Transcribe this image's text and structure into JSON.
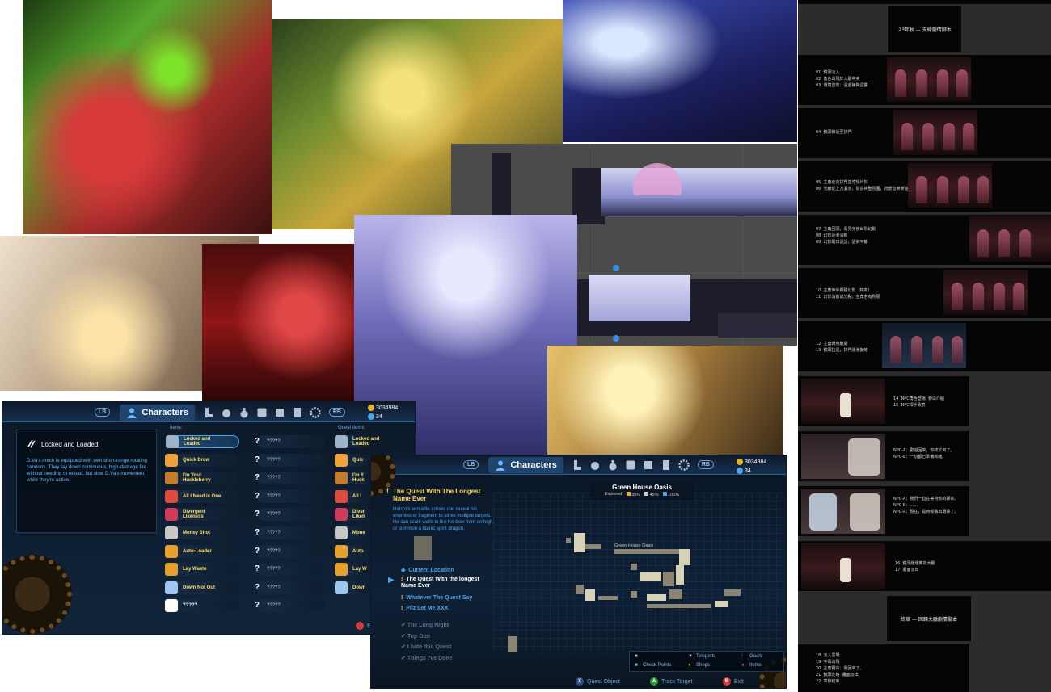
{
  "characters_ui": {
    "lb": "LB",
    "rb": "RB",
    "tab_label": "Characters",
    "gold": "3034984",
    "gems": "34",
    "detail": {
      "title": "Locked and Loaded",
      "description": "D.Va's mech is equipped with twin short-range rotating cannons. They lay down continuous, high-damage fire without needing to reload, but slow D.Va's movement while they're active."
    },
    "items_header": "Items",
    "quest_items_header": "Quest Items",
    "items": [
      {
        "label": "Locked and\nLoaded",
        "color": "#9fb3c8"
      },
      {
        "label": "Quick Draw",
        "color": "#f0a23a"
      },
      {
        "label": "I'm Your\nHuckleberry",
        "color": "#c27c2e"
      },
      {
        "label": "All I Need is One",
        "color": "#e04a3c"
      },
      {
        "label": "Divergent\nLikeness",
        "color": "#d23a5a"
      },
      {
        "label": "Money Shot",
        "color": "#c8c8c8"
      },
      {
        "label": "Auto-Loader",
        "color": "#e6a12c"
      },
      {
        "label": "Lay Waste",
        "color": "#e6a12c"
      },
      {
        "label": "Down Not Out",
        "color": "#9ec7f0"
      },
      {
        "label": "?????",
        "color": "#ffffff"
      }
    ],
    "unknown": "?????",
    "quest_items": [
      {
        "label": "Locked and\nLoaded",
        "color": "#9fb3c8"
      },
      {
        "label": "Quic",
        "color": "#f0a23a"
      },
      {
        "label": "I'm Y\nHuck",
        "color": "#c27c2e"
      },
      {
        "label": "All I",
        "color": "#e04a3c"
      },
      {
        "label": "Diver\nLiken",
        "color": "#d23a5a"
      },
      {
        "label": "Mone",
        "color": "#c8c8c8"
      },
      {
        "label": "Auto",
        "color": "#e6a12c"
      },
      {
        "label": "Lay W",
        "color": "#e6a12c"
      },
      {
        "label": "Down",
        "color": "#9ec7f0"
      }
    ],
    "exit_label": "E"
  },
  "quest_ui": {
    "lb": "LB",
    "rb": "RB",
    "tab_label": "Characters",
    "gold": "3034984",
    "gems": "34",
    "quest_title": "The Quest With The Longest Name Ever",
    "quest_description": "Hanzo's versatile arrows can reveal his enemies or fragment to strike multiple targets. He can scale walls to fire his bow from on high, or summon a titanic spirit dragon.",
    "map_title": "Green House Oasis",
    "explored_label": "Explored",
    "explored": [
      {
        "value": "35%",
        "color": "#e6b325"
      },
      {
        "value": "45%",
        "color": "#c8c8c8"
      },
      {
        "value": "100%",
        "color": "#4ea3e6"
      }
    ],
    "map_area_label": "Green House Oasis",
    "current_location": "Current Location",
    "quests_active": [
      {
        "label": "The Quest With the longest\nName Ever",
        "color": "#ffffff"
      },
      {
        "label": "Whatever The Quest Say",
        "color": "#4ea3e6"
      },
      {
        "label": "Pliz Let Me XXX",
        "color": "#4ea3e6"
      }
    ],
    "quests_done": [
      "The Long Night",
      "Top Gun",
      "I hate this Quest",
      "Things I've Done"
    ],
    "legend": {
      "check_points": "Check Points",
      "teleports": "Teleports",
      "shops": "Shops",
      "goals": "Goals",
      "items": "Items"
    },
    "actions": {
      "quest_object": "Quest Object",
      "track_target": "Track Target",
      "exit": "Exit"
    },
    "action_buttons": {
      "x": "X",
      "a": "A",
      "b": "B"
    }
  },
  "storyboard": {
    "title_1": "23年秋 — 支線劇情腳本",
    "title_2": "終章 — 回歸大廳劇情腳本",
    "notes": [
      "01  鏡頭淡入\n02  角色出現於大廳中央\n03  環境音效：遠處鐘聲迴響",
      "04  鏡頭推近至拱門",
      "05  主角走向拱門並停頓片刻\n06  光線從上方灑落，營造神聖氛圍，背景音樂漸強",
      "07  主角回頭，看見身後出現幻影\n08  幻影逐漸清晰\n09  幻影開口說話，語氣平靜",
      "10  主角伸手觸碰幻影（特寫）\n11  幻影消散成光點，主角若有所思",
      "12  主角轉身離開\n13  鏡頭拉遠，拱門逐漸變暗",
      "14  NPC角色登場  旁白介紹\n15  NPC揮手致意",
      "NPC-A：歡迎回來，你終於到了。\nNPC-B：一切都已準備就緒。",
      "NPC-A：我們一直在等待你的歸來。\nNPC-B：……\nNPC-A：現在，是時候做出選擇了。",
      "16  鏡頭緩緩推向大廳\n17  畫面淡出",
      "18  淡入黑場\n19  字幕出現\n20  主角獨白：我回來了。\n21  鏡頭定格  畫面淡出\n22  章節結束"
    ]
  }
}
